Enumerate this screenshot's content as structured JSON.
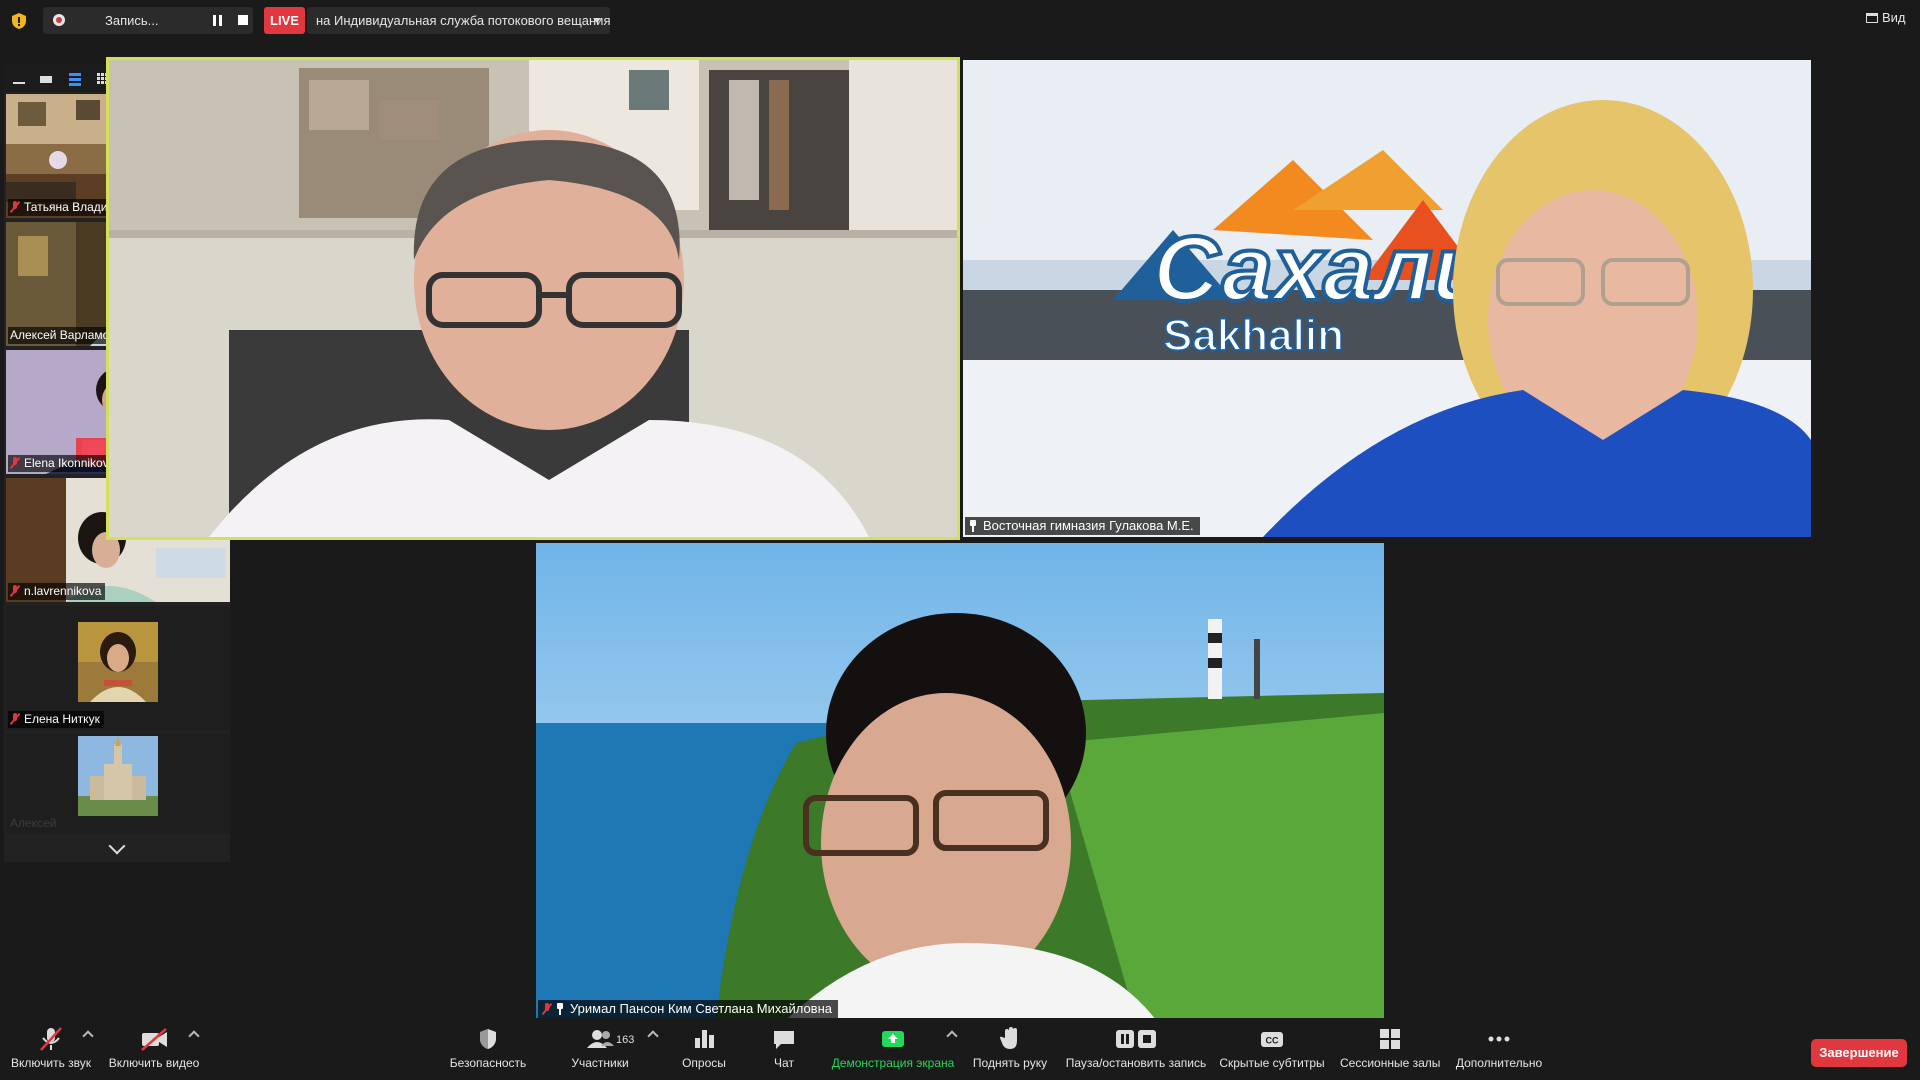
{
  "top_bar": {
    "recording_label": "Запись...",
    "live_badge": "LIVE",
    "stream_target": "на Индивидуальная служба потокового вещания",
    "view_label": "Вид"
  },
  "thumbnails": [
    {
      "name": "Татьяна Владимиро...",
      "muted": true
    },
    {
      "name": "Алексей Варламов",
      "muted": false
    },
    {
      "name": "Elena Ikonnikova",
      "muted": true
    },
    {
      "name": "n.lavrennikova",
      "muted": true
    },
    {
      "name": "Елена Ниткук",
      "muted": true
    },
    {
      "name": "Алексей",
      "muted": true
    }
  ],
  "main_tiles": {
    "speaker": {
      "name": ""
    },
    "right": {
      "name": "Восточная гимназия Гулакова М.Е."
    },
    "bottom": {
      "name": "Уримал Пансон Ким Светлана Михайловна"
    },
    "right_background_text": "Сахалин",
    "right_background_subtext": "Sakhalin"
  },
  "toolbar": {
    "unmute": "Включить звук",
    "start_video": "Включить видео",
    "security": "Безопасность",
    "participants": "Участники",
    "participants_count": "163",
    "polls": "Опросы",
    "chat": "Чат",
    "share_screen": "Демонстрация экрана",
    "raise_hand": "Поднять руку",
    "pause_stop_recording": "Пауза/остановить запись",
    "captions": "Скрытые субтитры",
    "breakout_rooms": "Сессионные залы",
    "more": "Дополнительно",
    "end": "Завершение"
  },
  "colors": {
    "background": "#1a1a1a",
    "live_red": "#e0383e",
    "active_speaker_border": "#d4e05a",
    "share_green": "#23d959"
  }
}
